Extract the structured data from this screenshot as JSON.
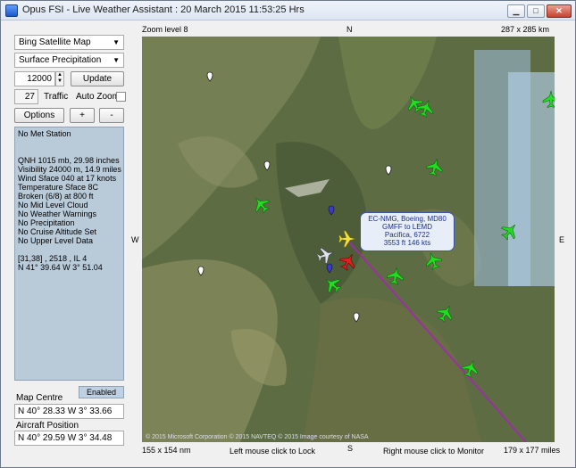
{
  "window": {
    "title": "Opus FSI - Live Weather Assistant : 20 March 2015  11:53:25 Hrs"
  },
  "controls": {
    "map_type": "Bing Satellite Map",
    "overlay": "Surface Precipitation",
    "altitude_value": "12000",
    "update_label": "Update",
    "traffic_value": "27",
    "traffic_label": "Traffic",
    "auto_zoom_label": "Auto Zoom",
    "options_label": "Options",
    "zoom_in_label": "+",
    "zoom_out_label": "-"
  },
  "info": {
    "lines": [
      "No Met Station",
      "",
      "",
      "QNH 1015 mb, 29.98 inches",
      "Visibility 24000 m, 14.9 miles",
      "Wind Sface 040 at 17 knots",
      "Temperature Sface 8C",
      "Broken (6/8) at 800 ft",
      "No Mid Level Cloud",
      "No Weather Warnings",
      "No Precipitation",
      "No Cruise Altitude Set",
      "No Upper Level Data",
      "",
      "[31,38] , 2518 , IL 4",
      "N 41° 39.64  W 3° 51.04"
    ]
  },
  "status_panel": {
    "enabled_label": "Enabled",
    "map_centre_label": "Map Centre",
    "map_centre_value": "N 40° 28.33  W 3° 33.66",
    "aircraft_position_label": "Aircraft Position",
    "aircraft_position_value": "N 40° 29.59  W 3° 34.48"
  },
  "map": {
    "zoom_label": "Zoom level 8",
    "north": "N",
    "south": "S",
    "east": "E",
    "west": "W",
    "top_right_size": "287 x 285 km",
    "bottom_left_size": "155 x 154 nm",
    "bottom_right_size": "179 x 177 miles",
    "left_hint": "Left mouse click to Lock",
    "right_hint": "Right mouse click to Monitor",
    "copyright": "© 2015 Microsoft Corporation  © 2015 NAVTEQ  © 2015 Image courtesy of NASA",
    "flight_info": {
      "line1": "EC-NMG, Boeing, MD80",
      "line2": "GMFF to LEMD",
      "line3": "Pacifica, 6722",
      "line4": "3553 ft  146 kts"
    }
  },
  "colors": {
    "traffic_plane": "#22dd22",
    "user_plane": "#e02020",
    "selected_plane": "#f2e23a",
    "route_line": "#9b2fa3",
    "info_bg": "#b9cad9"
  }
}
